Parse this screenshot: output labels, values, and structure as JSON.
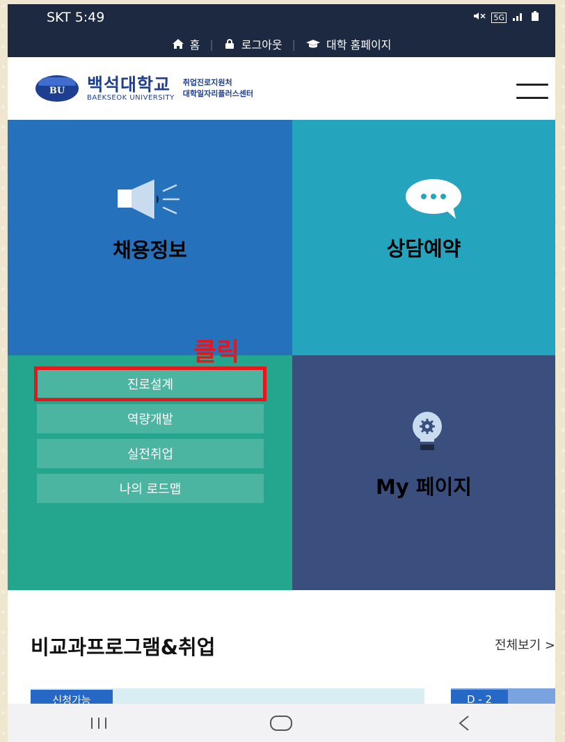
{
  "status_bar": {
    "carrier_time": "SKT 5:49",
    "network": "5G"
  },
  "utility_nav": {
    "home_label": "홈",
    "logout_label": "로그아웃",
    "univ_home_label": "대학 홈페이지",
    "separator": "|"
  },
  "header": {
    "logo_emblem": "BU",
    "logo_ko": "백석대학교",
    "logo_en": "BAEKSEOK UNIVERSITY",
    "sub_line1": "취업진로지원처",
    "sub_line2": "대학일자리플러스센터"
  },
  "tiles": {
    "jobs": {
      "title": "채용정보",
      "icon": "megaphone-icon",
      "color": "#2571bb"
    },
    "consult": {
      "title": "상담예약",
      "icon": "chat-bubble-icon",
      "color": "#25a4bd"
    },
    "career": {
      "color": "#24a58e",
      "items": [
        "진로설계",
        "역량개발",
        "실전취업",
        "나의 로드맵"
      ]
    },
    "my_page": {
      "title": "My 페이지",
      "icon": "lightbulb-gear-icon",
      "color": "#3b4f7f"
    }
  },
  "annotation": {
    "text": "클릭",
    "color": "#e8161b"
  },
  "section": {
    "title": "비교과프로그램&취업",
    "view_all": "전체보기 >",
    "badge_open": "신청가능",
    "badge_dday": "D - 2"
  },
  "nav_bar": {
    "recent": "recent-apps-icon",
    "home": "home-icon",
    "back": "back-icon"
  }
}
